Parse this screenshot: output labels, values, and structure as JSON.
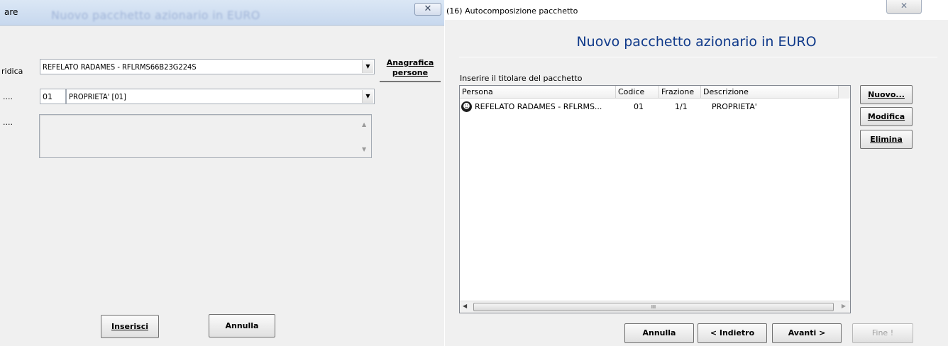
{
  "left_dialog": {
    "title_fragment": "are",
    "ghost_title": "Nuovo pacchetto azionario in EURO",
    "close_glyph": "✕",
    "labels": {
      "row1": "ridica",
      "row2": "....",
      "row3": "...."
    },
    "person_combo": {
      "value": "REFELATO RADAMES - RFLRMS66B23G224S"
    },
    "anagrafica_button": {
      "line1": "Anagrafica",
      "line2": "persone"
    },
    "code_box": {
      "value": "01"
    },
    "type_combo": {
      "value": "PROPRIETA' [01]"
    },
    "buttons": {
      "insert": "Inserisci",
      "cancel": "Annulla"
    }
  },
  "wizard": {
    "window_title": "(16) Autocomposizione pacchetto",
    "close_glyph": "✕",
    "heading": "Nuovo pacchetto azionario in EURO",
    "instruction": "Inserire il titolare del pacchetto",
    "table": {
      "columns": [
        "Persona",
        "Codice",
        "Frazione",
        "Descrizione"
      ],
      "rows": [
        {
          "persona": "REFELATO RADAMES - RFLRMS...",
          "codice": "01",
          "frazione": "1/1",
          "descrizione": "PROPRIETA'"
        }
      ],
      "scroll_grip": "III"
    },
    "side_buttons": {
      "new": "Nuovo...",
      "edit": "Modifica",
      "delete": "Elimina"
    },
    "footer_buttons": {
      "cancel": "Annulla",
      "back": "< Indietro",
      "next": "Avanti >",
      "finish": "Fine !"
    }
  }
}
